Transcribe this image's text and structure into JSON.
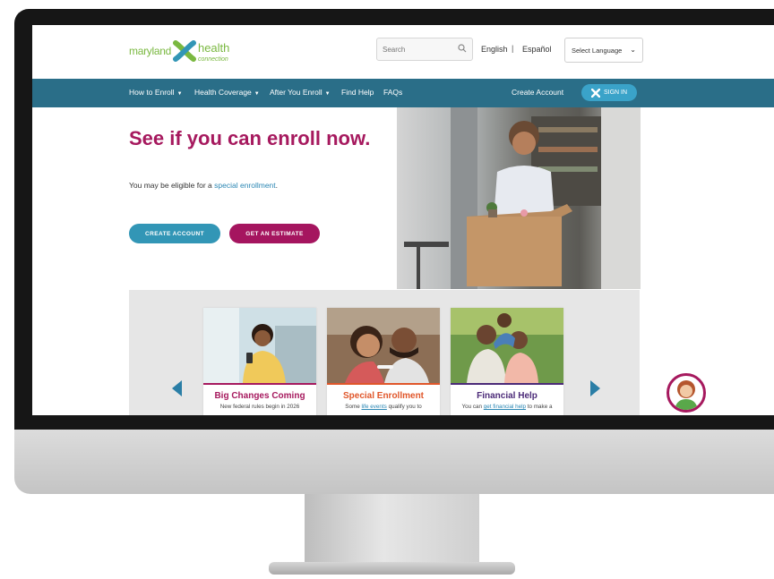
{
  "header": {
    "logo": {
      "maryland": "maryland",
      "health": "health",
      "connection": "connection"
    },
    "search": {
      "placeholder": "Search"
    },
    "languages": {
      "english": "English",
      "separator": "|",
      "espanol": "Español"
    },
    "select_language": "Select Language"
  },
  "nav": {
    "items": [
      {
        "label": "How to Enroll"
      },
      {
        "label": "Health Coverage"
      },
      {
        "label": "After You Enroll"
      },
      {
        "label": "Find Help"
      },
      {
        "label": "FAQs"
      }
    ],
    "create_account": "Create Account",
    "sign_in": "SIGN IN"
  },
  "hero": {
    "title": "See if you can enroll now.",
    "text_before": "You may be eligible for a ",
    "link": "special enrollment",
    "text_after": ".",
    "create_button": "CREATE ACCOUNT",
    "estimate_button": "GET AN ESTIMATE"
  },
  "cards": [
    {
      "title": "Big Changes Coming",
      "text": "New federal rules begin in 2026",
      "color": "#a6195e"
    },
    {
      "title": "Special Enrollment",
      "text_before": "Some ",
      "link": "life events",
      "text_after": " qualify you to",
      "color": "#e0562a"
    },
    {
      "title": "Financial Help",
      "text_before": "You can ",
      "link": "get financial help",
      "text_after": " to make a",
      "color": "#4b2a78"
    }
  ],
  "colors": {
    "nav": "#2a6e88",
    "brand_magenta": "#a6195e",
    "accent_blue": "#3296b6",
    "logo_green": "#7ab840"
  }
}
